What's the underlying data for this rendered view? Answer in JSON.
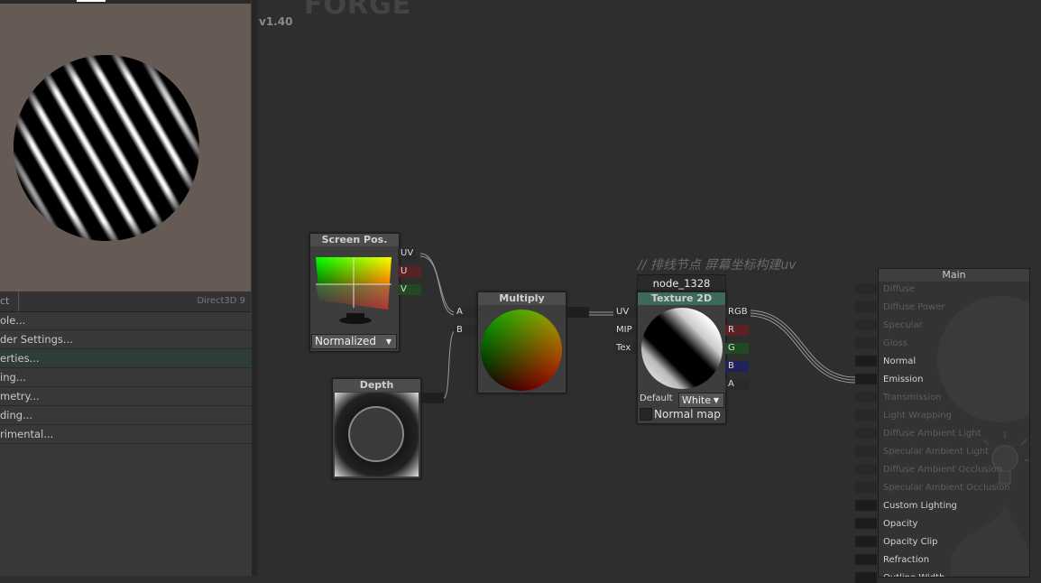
{
  "header": {
    "logo_text": "FORGE",
    "version": "v1.40"
  },
  "left_panel": {
    "tab_label": "ct",
    "api_label": "Direct3D 9",
    "menu_items": [
      "ole...",
      "der Settings...",
      "erties...",
      "ing...",
      "metry...",
      "ding...",
      "rimental..."
    ],
    "selected_index": 2
  },
  "nodes": {
    "screen_pos": {
      "title": "Screen Pos.",
      "outputs": [
        "UV",
        "U",
        "V"
      ],
      "mode_value": "Normalized"
    },
    "depth": {
      "title": "Depth"
    },
    "multiply": {
      "title": "Multiply",
      "inputs": [
        "A",
        "B"
      ]
    },
    "texture2d": {
      "id_label": "node_1328",
      "title": "Texture 2D",
      "inputs": [
        "UV",
        "MIP",
        "Tex"
      ],
      "outputs": [
        "RGB",
        "R",
        "G",
        "B",
        "A"
      ],
      "default_label": "Default",
      "default_value": "White",
      "normal_map_label": "Normal map",
      "normal_map_checked": false
    }
  },
  "comment": "// 排线节点 屏幕坐标构建uv",
  "main_node": {
    "title": "Main",
    "inputs": [
      {
        "label": "Diffuse",
        "enabled": false
      },
      {
        "label": "Diffuse Power",
        "enabled": false
      },
      {
        "label": "Specular",
        "enabled": false
      },
      {
        "label": "Gloss",
        "enabled": false
      },
      {
        "label": "Normal",
        "enabled": true
      },
      {
        "label": "Emission",
        "enabled": true
      },
      {
        "label": "Transmission",
        "enabled": false
      },
      {
        "label": "Light Wrapping",
        "enabled": false
      },
      {
        "label": "Diffuse Ambient Light",
        "enabled": false
      },
      {
        "label": "Specular Ambient Light",
        "enabled": false
      },
      {
        "label": "Diffuse Ambient Occlusion",
        "enabled": false
      },
      {
        "label": "Specular Ambient Occlusion",
        "enabled": false
      },
      {
        "label": "Custom Lighting",
        "enabled": true
      },
      {
        "label": "Opacity",
        "enabled": true
      },
      {
        "label": "Opacity Clip",
        "enabled": true
      },
      {
        "label": "Refraction",
        "enabled": true
      },
      {
        "label": "Outline Width",
        "enabled": true
      }
    ]
  },
  "colors": {
    "canvas_bg": "#2e2e2e",
    "preview_bg": "#665b54",
    "selected_row": "#2f3d3a",
    "port_r": "#5a2222",
    "port_g": "#224a22",
    "port_b": "#22225a"
  }
}
